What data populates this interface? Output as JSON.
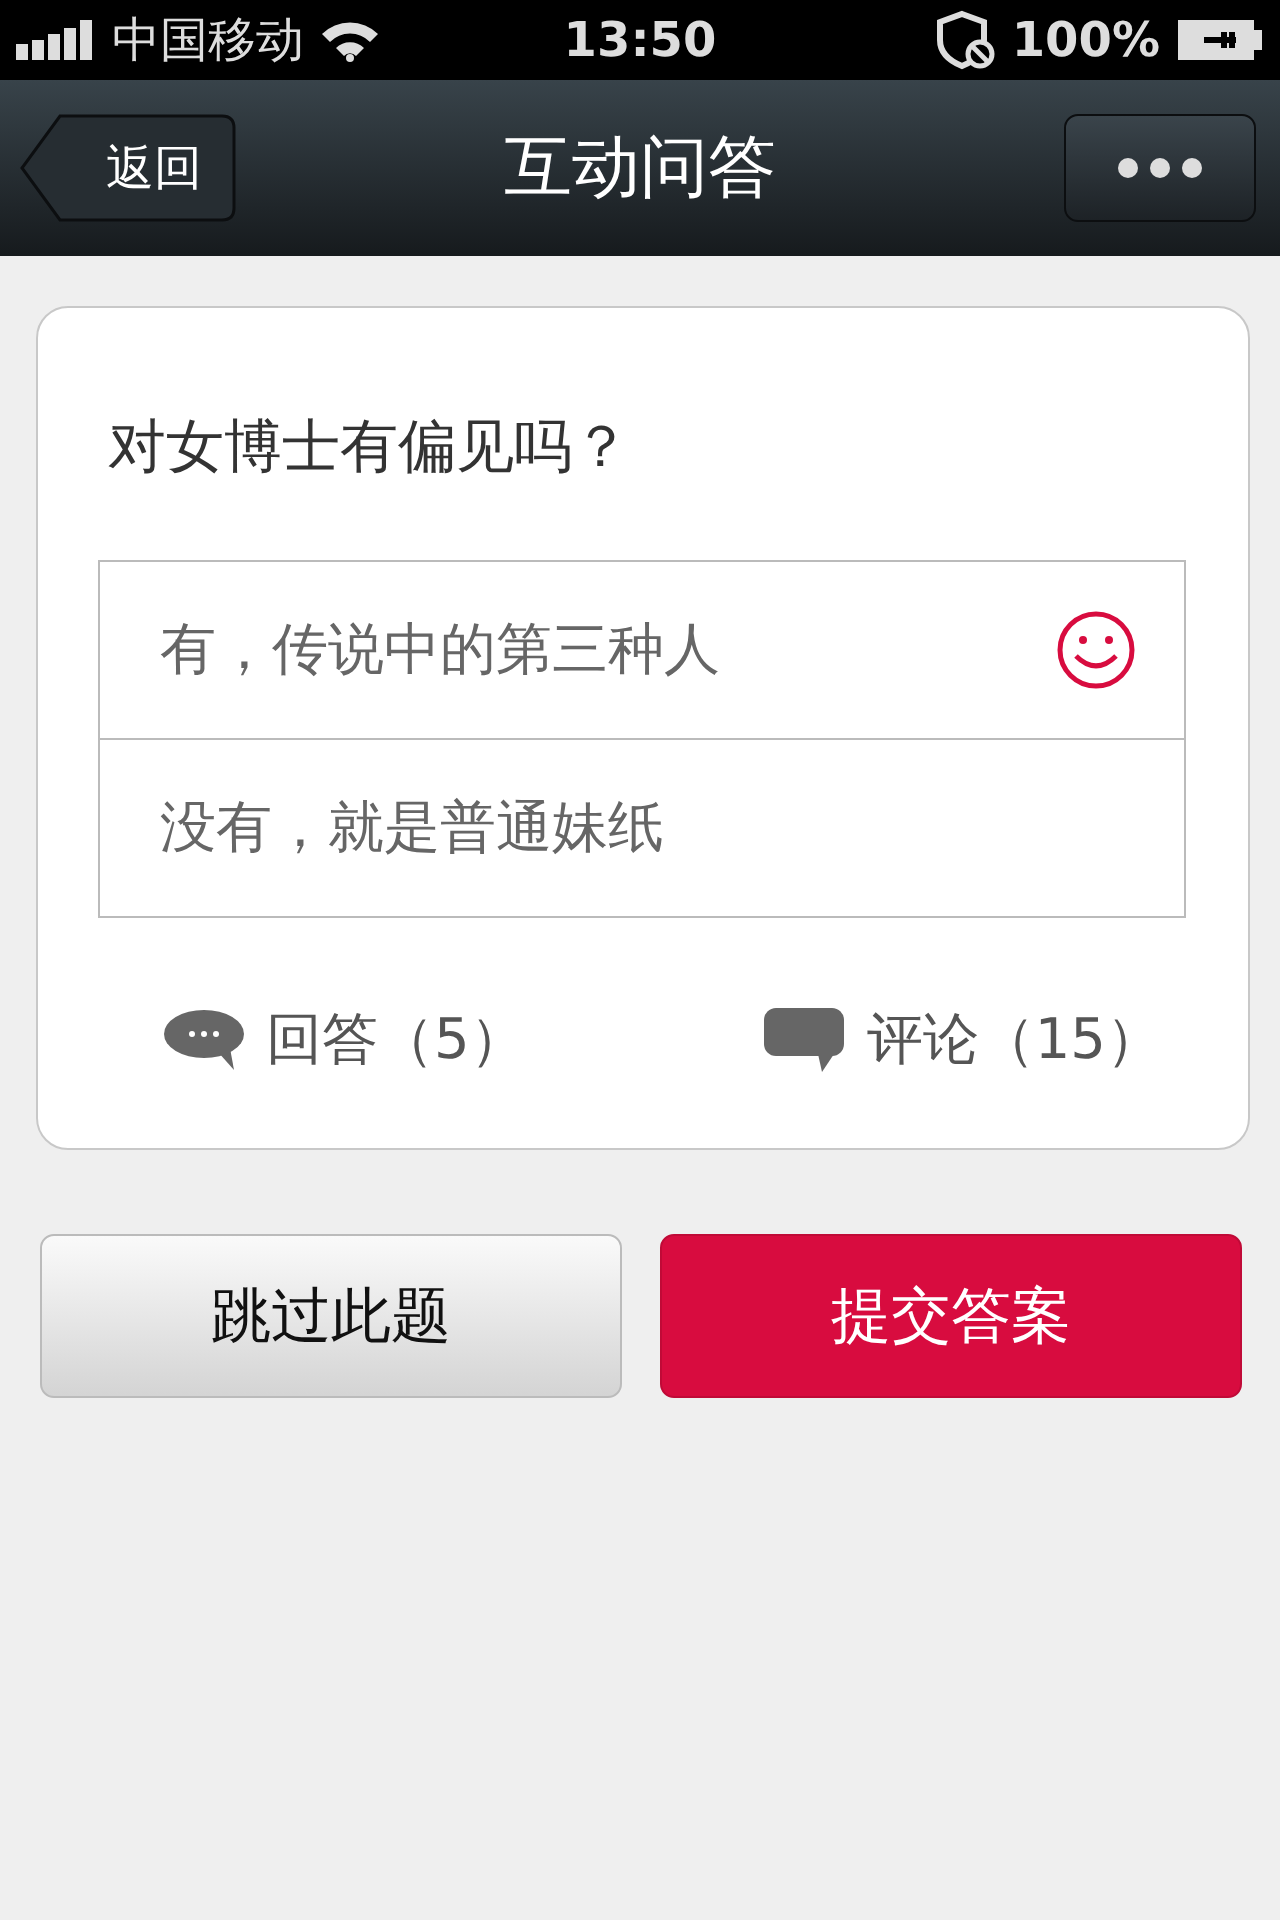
{
  "status_bar": {
    "carrier": "中国移动",
    "time": "13:50",
    "battery": "100%"
  },
  "nav_bar": {
    "back": "返回",
    "title": "互动问答"
  },
  "question": {
    "text": "对女博士有偏见吗？",
    "options": [
      {
        "label": "有，传说中的第三种人",
        "selected": true
      },
      {
        "label": "没有，就是普通妹纸",
        "selected": false
      }
    ],
    "answers": "回答（5）",
    "comments": "评论（15）"
  },
  "buttons": [
    {
      "label": "跳过此题",
      "kind": "secondary"
    },
    {
      "label": "提交答案",
      "kind": "primary"
    }
  ]
}
